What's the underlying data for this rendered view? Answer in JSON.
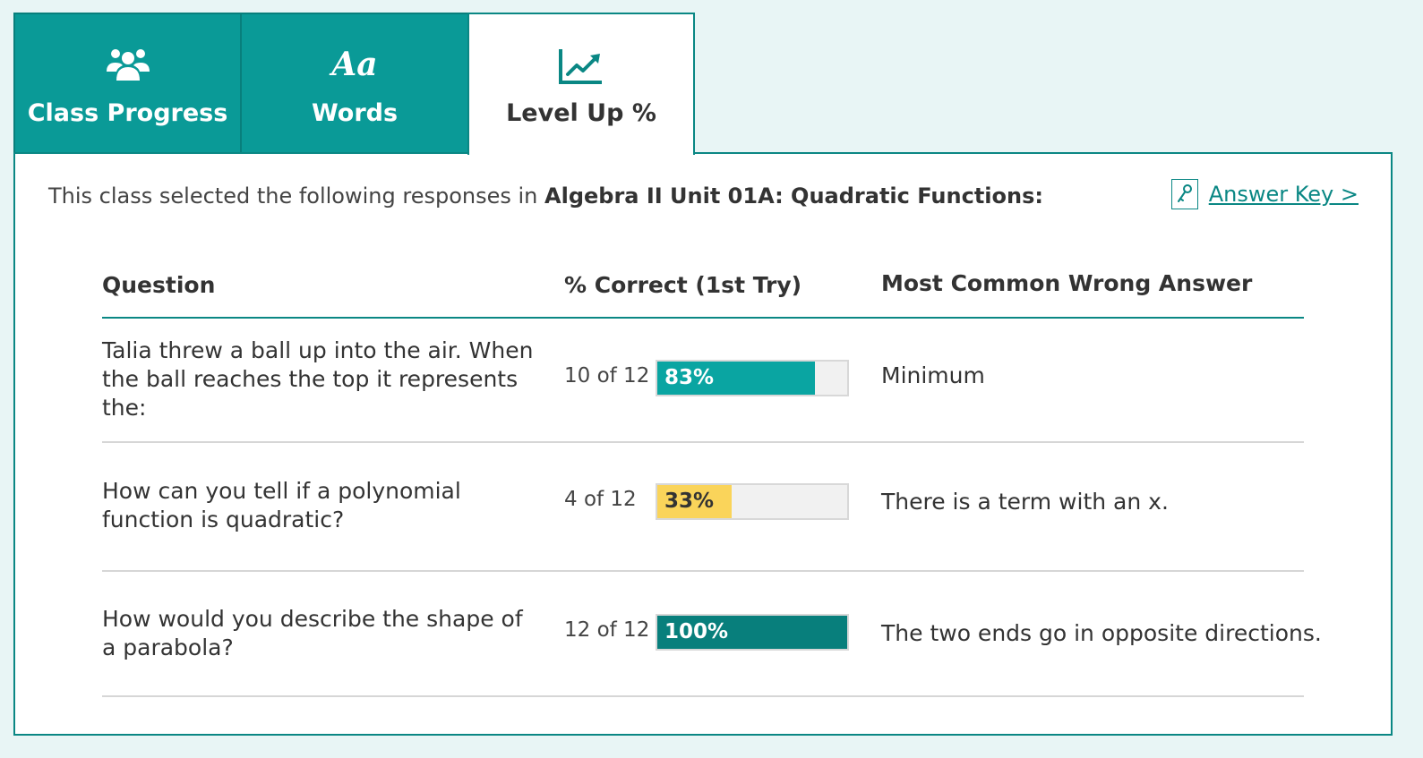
{
  "tabs": [
    {
      "label": "Class Progress",
      "icon": "users-icon"
    },
    {
      "label": "Words",
      "icon": "aa-text-icon",
      "glyph": "Aa"
    },
    {
      "label": "Level Up %",
      "icon": "chart-line-up-icon"
    }
  ],
  "intro": {
    "prefix": "This class selected the following responses in ",
    "unit": "Algebra II Unit 01A: Quadratic Functions:"
  },
  "answer_key": {
    "label": "Answer Key >",
    "icon": "key-icon"
  },
  "table": {
    "headers": {
      "question": "Question",
      "correct": "% Correct (1st Try)",
      "wrong": "Most Common Wrong Answer"
    },
    "rows": [
      {
        "question": "Talia threw a ball up into the air. When the ball reaches the top it represents the:",
        "count": "10 of 12",
        "percent_label": "83%",
        "fraction": 0.83,
        "bar_color": "#0aa5a2",
        "label_color": "#ffffff",
        "wrong_answer": "Minimum"
      },
      {
        "question": "How can you tell if a polynomial function is quadratic?",
        "count": "4 of 12",
        "percent_label": "33%",
        "fraction": 0.39,
        "bar_color": "#fad45a",
        "label_color": "#333333",
        "wrong_answer": "There is a term with an x."
      },
      {
        "question": "How would you describe the shape of a parabola?",
        "count": "12 of 12",
        "percent_label": "100%",
        "fraction": 1.0,
        "bar_color": "#087f7c",
        "label_color": "#ffffff",
        "wrong_answer": "The two ends go in opposite directions."
      }
    ]
  },
  "colors": {
    "accent": "#0a9a97",
    "accent_dark": "#087f7c",
    "page_bg": "#e8f5f5"
  }
}
